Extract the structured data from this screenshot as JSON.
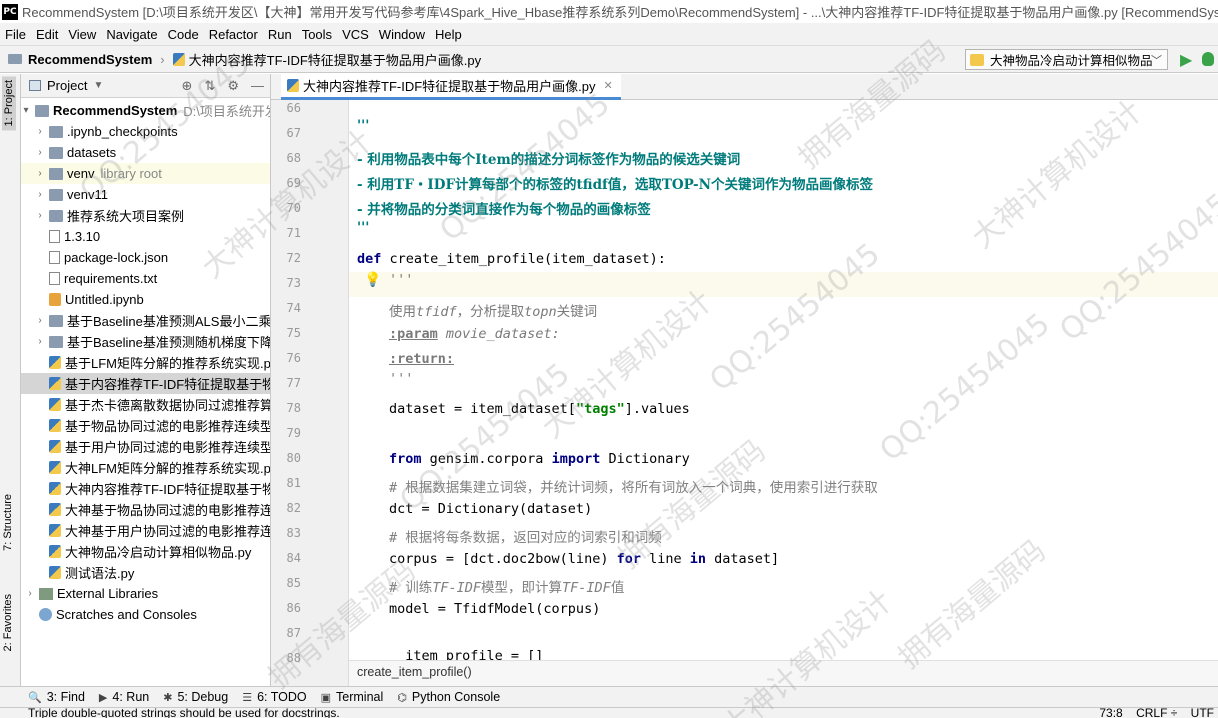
{
  "window": {
    "logo": "PC",
    "title": "RecommendSystem [D:\\项目系统开发区\\【大神】常用开发写代码参考库\\4Spark_Hive_Hbase推荐系统系列Demo\\RecommendSystem] - ...\\大神内容推荐TF-IDF特征提取基于物品用户画像.py [RecommendSystem] - Py..."
  },
  "menu": [
    "File",
    "Edit",
    "View",
    "Navigate",
    "Code",
    "Refactor",
    "Run",
    "Tools",
    "VCS",
    "Window",
    "Help"
  ],
  "nav": {
    "project": "RecommendSystem",
    "file": "大神内容推荐TF-IDF特征提取基于物品用户画像.py",
    "run_config": "大神物品冷启动计算相似物品"
  },
  "side_tabs": {
    "project": "1: Project",
    "structure": "7: Structure",
    "favorites": "2: Favorites"
  },
  "project_panel": {
    "title": "Project",
    "root": "RecommendSystem",
    "root_path": "D:\\项目系统开发区",
    "items": [
      {
        "label": ".ipynb_checkpoints",
        "extra": ""
      },
      {
        "label": "datasets",
        "extra": ""
      },
      {
        "label": "venv",
        "extra": "library root"
      },
      {
        "label": "venv11",
        "extra": ""
      },
      {
        "label": "推荐系统大项目案例",
        "extra": ""
      },
      {
        "label": "1.3.10",
        "extra": ""
      },
      {
        "label": "package-lock.json",
        "extra": ""
      },
      {
        "label": "requirements.txt",
        "extra": ""
      },
      {
        "label": "Untitled.ipynb",
        "extra": ""
      },
      {
        "label": "基于Baseline基准预测ALS最小二乘法回",
        "extra": ""
      },
      {
        "label": "基于Baseline基准预测随机梯度下降回归",
        "extra": ""
      },
      {
        "label": "基于LFM矩阵分解的推荐系统实现.py",
        "extra": ""
      },
      {
        "label": "基于内容推荐TF-IDF特征提取基于物品用",
        "extra": ""
      },
      {
        "label": "基于杰卡德离散数据协同过滤推荐算法实",
        "extra": ""
      },
      {
        "label": "基于物品协同过滤的电影推荐连续型评分",
        "extra": ""
      },
      {
        "label": "基于用户协同过滤的电影推荐连续型评分",
        "extra": ""
      },
      {
        "label": "大神LFM矩阵分解的推荐系统实现.py",
        "extra": ""
      },
      {
        "label": "大神内容推荐TF-IDF特征提取基于物品用",
        "extra": ""
      },
      {
        "label": "大神基于物品协同过滤的电影推荐连续型",
        "extra": ""
      },
      {
        "label": "大神基于用户协同过滤的电影推荐连续型",
        "extra": ""
      },
      {
        "label": "大神物品冷启动计算相似物品.py",
        "extra": ""
      },
      {
        "label": "测试语法.py",
        "extra": ""
      }
    ],
    "external": "External Libraries",
    "scratches": "Scratches and Consoles"
  },
  "editor": {
    "tab": "大神内容推荐TF-IDF特征提取基于物品用户画像.py",
    "line_numbers": [
      "66",
      "67",
      "68",
      "69",
      "70",
      "71",
      "72",
      "73",
      "74",
      "75",
      "76",
      "77",
      "78",
      "79",
      "80",
      "81",
      "82",
      "83",
      "84",
      "85",
      "86",
      "87",
      "88"
    ],
    "lines": {
      "l67": "'''",
      "l68": "- 利用物品表中每个Item的描述分词标签作为物品的候选关键词",
      "l69": "- 利用TF・IDF计算每部个的标签的tfidf值，选取TOP-N个关键词作为物品画像标签",
      "l70": "- 并将物品的分类词直接作为每个物品的画像标签",
      "l71": "'''",
      "l72_kw": "def",
      "l72_rest": " create_item_profile(item_dataset):",
      "l73": "'''",
      "l74a": "使用",
      "l74b": "tfidf",
      "l74c": "，分析提取",
      "l74d": "topn",
      "l74e": "关键词",
      "l75a": ":param",
      "l75b": " movie_dataset:",
      "l76": ":return:",
      "l77": "'''",
      "l78a": "dataset = item_dataset[",
      "l78b": "\"tags\"",
      "l78c": "].values",
      "l80_kw1": "from",
      "l80_mid": " gensim.corpora ",
      "l80_kw2": "import",
      "l80_end": " Dictionary",
      "l81": "# 根据数据集建立词袋，并统计词频，将所有词放入一个词典，使用索引进行获取",
      "l82": "dct = Dictionary(dataset)",
      "l83": "# 根据将每条数据，返回对应的词索引和词频",
      "l84a": "corpus = [dct.doc2bow(line) ",
      "l84b": "for",
      "l84c": " line ",
      "l84d": "in",
      "l84e": " dataset]",
      "l85a": "# 训练",
      "l85b": "TF-IDF",
      "l85c": "模型，即计算",
      "l85d": "TF-IDF",
      "l85e": "值",
      "l86": "model = TfidfModel(corpus)",
      "l88": "  item_profile = []"
    },
    "breadcrumb": "create_item_profile()"
  },
  "bottom_tools": [
    {
      "icon": "search-icon",
      "label": "3: Find"
    },
    {
      "icon": "run-icon",
      "label": "4: Run"
    },
    {
      "icon": "debug-icon",
      "label": "5: Debug"
    },
    {
      "icon": "todo-icon",
      "label": "6: TODO"
    },
    {
      "icon": "terminal-icon",
      "label": "Terminal"
    },
    {
      "icon": "python-console-icon",
      "label": "Python Console"
    }
  ],
  "status": {
    "message": "Triple double-quoted strings should be used for docstrings.",
    "position": "73:8",
    "line_sep": "CRLF ÷",
    "encoding": "UTF"
  },
  "watermarks": [
    "QQ:25454045",
    "大神计算机设计",
    "拥有海量源码",
    "QQ:25454045",
    "大神计算机设计",
    "拥有海量源码",
    "QQ:25454045",
    "拥有海量源码",
    "QQ:25454045",
    "大神计算机设计",
    "QQ:25454045",
    "拥有海量源码",
    "大神计算机设计",
    "QQ:25454045"
  ]
}
